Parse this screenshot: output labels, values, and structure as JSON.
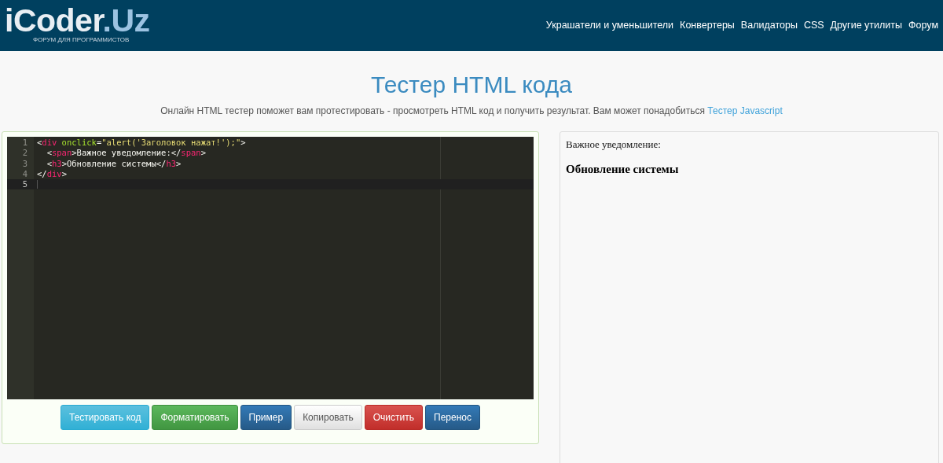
{
  "header": {
    "logo": {
      "main": "iCoder",
      "suffix": ".Uz",
      "tagline": "ФОРУМ ДЛЯ ПРОГРАММИСТОВ"
    },
    "nav": [
      "Украшатели и уменьшители",
      "Конвертеры",
      "Валидаторы",
      "CSS",
      "Другие утилиты",
      "Форум"
    ]
  },
  "page": {
    "title": "Тестер HTML кода",
    "intro": "Онлайн HTML тестер поможет вам протестировать - просмотреть HTML код и получить результат. Вам может понадобиться",
    "intro_link": "Тестер Javascript"
  },
  "editor": {
    "lines": [
      {
        "number": "1",
        "active": false,
        "tokens": [
          {
            "kind": "punct",
            "text": "<"
          },
          {
            "kind": "tag",
            "text": "div"
          },
          {
            "kind": "attr",
            "text": " onclick"
          },
          {
            "kind": "punct",
            "text": "="
          },
          {
            "kind": "string",
            "text": "\"alert('Заголовок нажат!');\""
          },
          {
            "kind": "punct",
            "text": ">"
          }
        ]
      },
      {
        "number": "2",
        "active": false,
        "tokens": [
          {
            "kind": "punct",
            "text": "  <"
          },
          {
            "kind": "tag",
            "text": "span"
          },
          {
            "kind": "punct",
            "text": ">"
          },
          {
            "kind": "text",
            "text": "Важное уведомление:"
          },
          {
            "kind": "punct",
            "text": "</"
          },
          {
            "kind": "tag",
            "text": "span"
          },
          {
            "kind": "punct",
            "text": ">"
          }
        ]
      },
      {
        "number": "3",
        "active": false,
        "tokens": [
          {
            "kind": "punct",
            "text": "  <"
          },
          {
            "kind": "tag",
            "text": "h3"
          },
          {
            "kind": "punct",
            "text": ">"
          },
          {
            "kind": "text",
            "text": "Обновление системы"
          },
          {
            "kind": "punct",
            "text": "</"
          },
          {
            "kind": "tag",
            "text": "h3"
          },
          {
            "kind": "punct",
            "text": ">"
          }
        ]
      },
      {
        "number": "4",
        "active": false,
        "tokens": [
          {
            "kind": "punct",
            "text": "</"
          },
          {
            "kind": "tag",
            "text": "div"
          },
          {
            "kind": "punct",
            "text": ">"
          }
        ]
      },
      {
        "number": "5",
        "active": true
      }
    ]
  },
  "buttons": [
    {
      "label": "Тестировать код",
      "kind": "info"
    },
    {
      "label": "Форматировать",
      "kind": "success"
    },
    {
      "label": "Пример",
      "kind": "primary"
    },
    {
      "label": "Копировать",
      "kind": "default"
    },
    {
      "label": "Очистить",
      "kind": "danger"
    },
    {
      "label": "Перенос",
      "kind": "primary"
    }
  ],
  "preview": {
    "text": "Важное уведомление:",
    "heading": "Обновление системы"
  }
}
